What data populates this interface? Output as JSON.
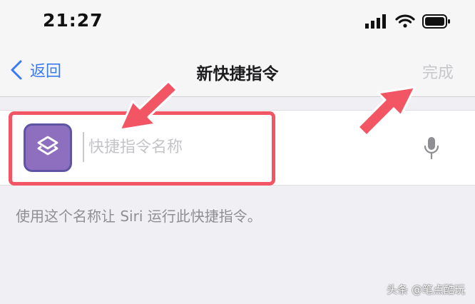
{
  "status_bar": {
    "time": "21:27"
  },
  "nav": {
    "back_label": "返回",
    "title": "新快捷指令",
    "done_label": "完成"
  },
  "shortcut_name": {
    "placeholder": "快捷指令名称",
    "value": ""
  },
  "hint_text": "使用这个名称让 Siri 运行此快捷指令。",
  "watermark": "头条 @笔点酷玩",
  "colors": {
    "accent": "#3a7bf0",
    "icon_bg": "#8e6fbf",
    "annotation": "#f25563",
    "done_disabled": "#c7c7cc"
  }
}
